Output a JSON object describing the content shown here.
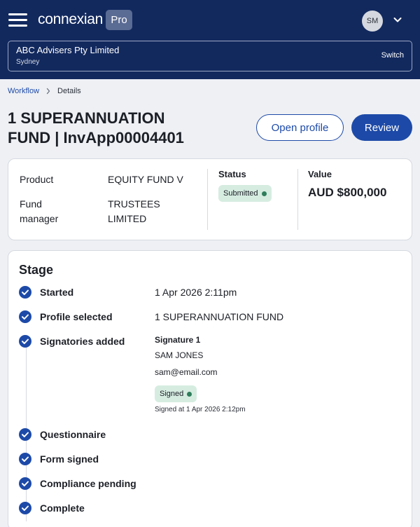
{
  "header": {
    "brand": "connexian",
    "tier_badge": "Pro",
    "user_initials": "SM",
    "org_name": "ABC Advisers Pty Limited",
    "org_location": "Sydney",
    "switch_label": "Switch"
  },
  "breadcrumb": {
    "parent": "Workflow",
    "current": "Details"
  },
  "page": {
    "title_line1": "1 SUPERANNUATION",
    "title_line2": "FUND | InvApp00004401",
    "open_profile_label": "Open profile",
    "review_label": "Review"
  },
  "summary": {
    "product_label": "Product",
    "product_value": "EQUITY FUND V",
    "fund_manager_label_line1": "Fund",
    "fund_manager_label_line2": "manager",
    "fund_manager_value_line1": "TRUSTEES",
    "fund_manager_value_line2": "LIMITED",
    "status_label": "Status",
    "status_value": "Submitted",
    "value_label": "Value",
    "value_amount": "AUD $800,000"
  },
  "stage": {
    "title": "Stage",
    "steps": [
      {
        "label": "Started",
        "value": "1 Apr 2026 2:11pm"
      },
      {
        "label": "Profile selected",
        "value": "1 SUPERANNUATION FUND"
      },
      {
        "label": "Signatories added",
        "value": ""
      },
      {
        "label": "Questionnaire",
        "value": ""
      },
      {
        "label": "Form signed",
        "value": ""
      },
      {
        "label": "Compliance pending",
        "value": ""
      },
      {
        "label": "Complete",
        "value": ""
      }
    ],
    "signatory": {
      "heading": "Signature 1",
      "name": "SAM JONES",
      "email": "sam@email.com",
      "status": "Signed",
      "signed_at": "Signed at 1 Apr 2026 2:12pm"
    }
  },
  "colors": {
    "header_navy": "#12295e",
    "primary_blue": "#1d4aa8",
    "status_green_bg": "#d6ece1",
    "status_green_dot": "#2e7d5b"
  },
  "icons": {
    "menu": "hamburger-menu-icon",
    "account_dropdown": "chevron-down-icon",
    "breadcrumb_separator": "chevron-right-icon",
    "step_complete": "check-circle-icon"
  }
}
